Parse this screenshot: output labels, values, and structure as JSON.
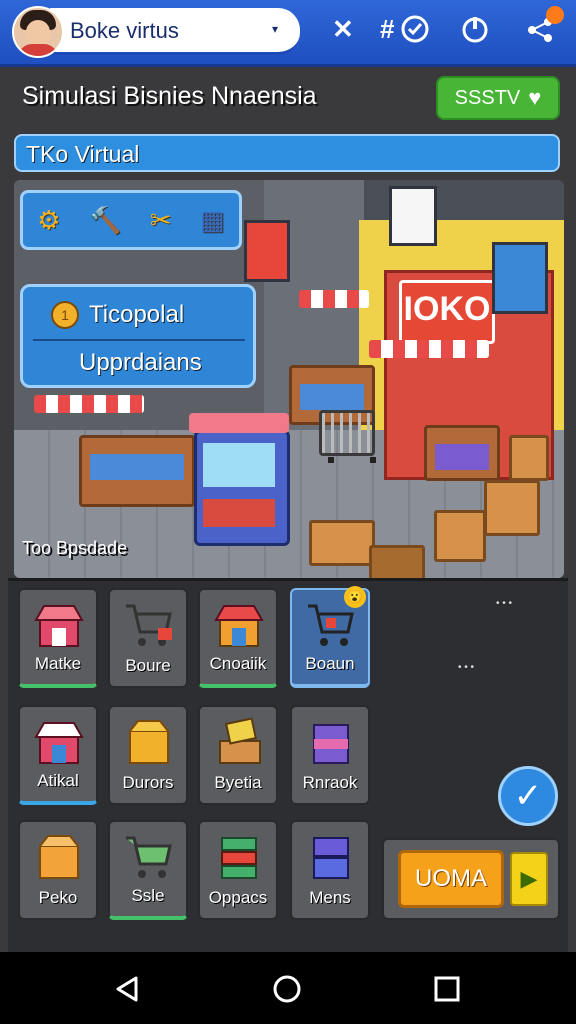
{
  "topbar": {
    "title": "Boke virtus",
    "caret": "▾",
    "close_glyph": "✕",
    "hash_glyph": "#"
  },
  "header": {
    "title": "Simulasi Bisnies Nnaensia",
    "status_label": "SSSTV",
    "heart": "♥"
  },
  "shop_bar": {
    "label": "TKo Virtual"
  },
  "scene": {
    "sign": "IOKO",
    "caption": "Too Bpsdade"
  },
  "menu": {
    "item1": "Ticopolal",
    "item2": "Upprdaians",
    "coin": "1"
  },
  "tools": [
    "⚙",
    "🔨",
    "✂",
    "▦"
  ],
  "inventory": {
    "row1": [
      "Matke",
      "Boure",
      "Cnoaiik",
      "Boaun"
    ],
    "row2": [
      "Atikal",
      "Durors",
      "Byetia",
      "Rnraok"
    ],
    "row3": [
      "Peko",
      "Ssle",
      "Oppacs",
      "Mens"
    ]
  },
  "badge": "😮",
  "check_glyph": "✓",
  "action": {
    "label": "UOMA",
    "play": "▶"
  },
  "colors": {
    "topbar": "#2f67d8",
    "accent_green": "#49b536",
    "panel_blue": "#2f86d6",
    "action_orange": "#f5a21a"
  }
}
